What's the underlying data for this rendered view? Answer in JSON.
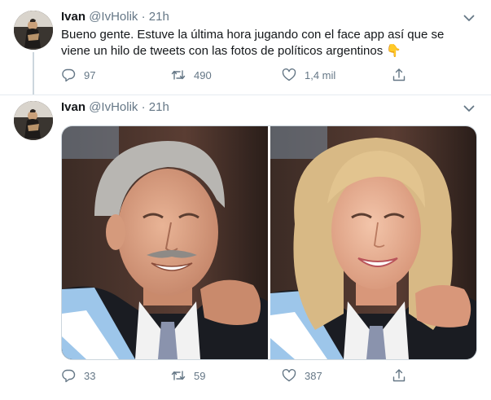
{
  "tweets": [
    {
      "name": "Ivan",
      "handle": "@IvHolik",
      "separator": "·",
      "time": "21h",
      "text": "Bueno gente. Estuve la última hora jugando con el face app así que se viene un hilo de tweets con las fotos de políticos argentinos",
      "emoji": "👇",
      "replies": "97",
      "retweets": "490",
      "likes": "1,4 mil"
    },
    {
      "name": "Ivan",
      "handle": "@IvHolik",
      "separator": "·",
      "time": "21h",
      "replies": "33",
      "retweets": "59",
      "likes": "387",
      "media": [
        "photo-original-man",
        "photo-faceapp-woman"
      ]
    }
  ],
  "icons": {
    "reply": "reply-icon",
    "retweet": "retweet-icon",
    "like": "like-icon",
    "share": "share-icon",
    "more": "chevron-down-icon"
  },
  "colors": {
    "text": "#14171a",
    "secondary": "#657786",
    "border": "#e6ecf0",
    "emoji": "#f5c33b"
  }
}
